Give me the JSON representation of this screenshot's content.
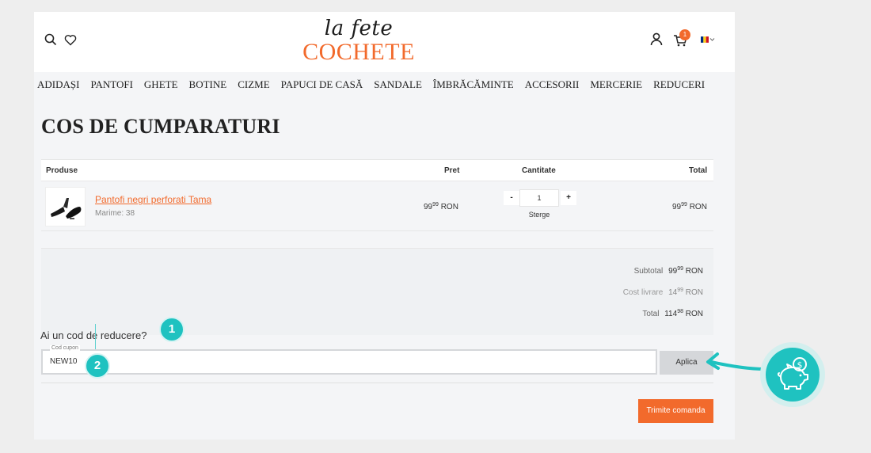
{
  "header": {
    "logo_script": "la fete",
    "logo_main": "COCHETE",
    "cart_count": "1",
    "icons": [
      "search-icon",
      "heart-icon",
      "user-icon",
      "cart-icon",
      "flag-ro-icon",
      "chevron-down-icon"
    ]
  },
  "nav": {
    "items": [
      "ADIDAȘI",
      "PANTOFI",
      "GHETE",
      "BOTINE",
      "CIZME",
      "PAPUCI DE CASĂ",
      "SANDALE",
      "ÎMBRĂCĂMINTE",
      "ACCESORII",
      "MERCERIE",
      "REDUCERI"
    ]
  },
  "page_title": "COS DE CUMPARATURI",
  "cart_table": {
    "headers": {
      "products": "Produse",
      "price": "Pret",
      "quantity": "Cantitate",
      "total": "Total"
    },
    "rows": [
      {
        "name": "Pantofi negri perforati Tama",
        "size": "Marime: 38",
        "price_int": "99",
        "price_dec": "99",
        "price_cur": "RON",
        "qty_minus": "-",
        "qty": "1",
        "qty_plus": "+",
        "remove": "Sterge",
        "total_int": "99",
        "total_dec": "99",
        "total_cur": "RON"
      }
    ]
  },
  "summary": {
    "subtotal_label": "Subtotal",
    "subtotal_int": "99",
    "subtotal_dec": "99",
    "shipping_label": "Cost livrare",
    "shipping_int": "14",
    "shipping_dec": "99",
    "total_label": "Total",
    "total_int": "114",
    "total_dec": "98",
    "currency": "RON"
  },
  "coupon": {
    "question": "Ai un cod de reducere?",
    "field_label": "Cod cupon",
    "value": "NEW10",
    "apply_label": "Aplica"
  },
  "submit_label": "Trimite comanda",
  "annotations": {
    "step1": "1",
    "step2": "2"
  },
  "colors": {
    "accent": "#f26a2c",
    "teal": "#1fc2c0",
    "button_gray": "#d5d7da"
  }
}
